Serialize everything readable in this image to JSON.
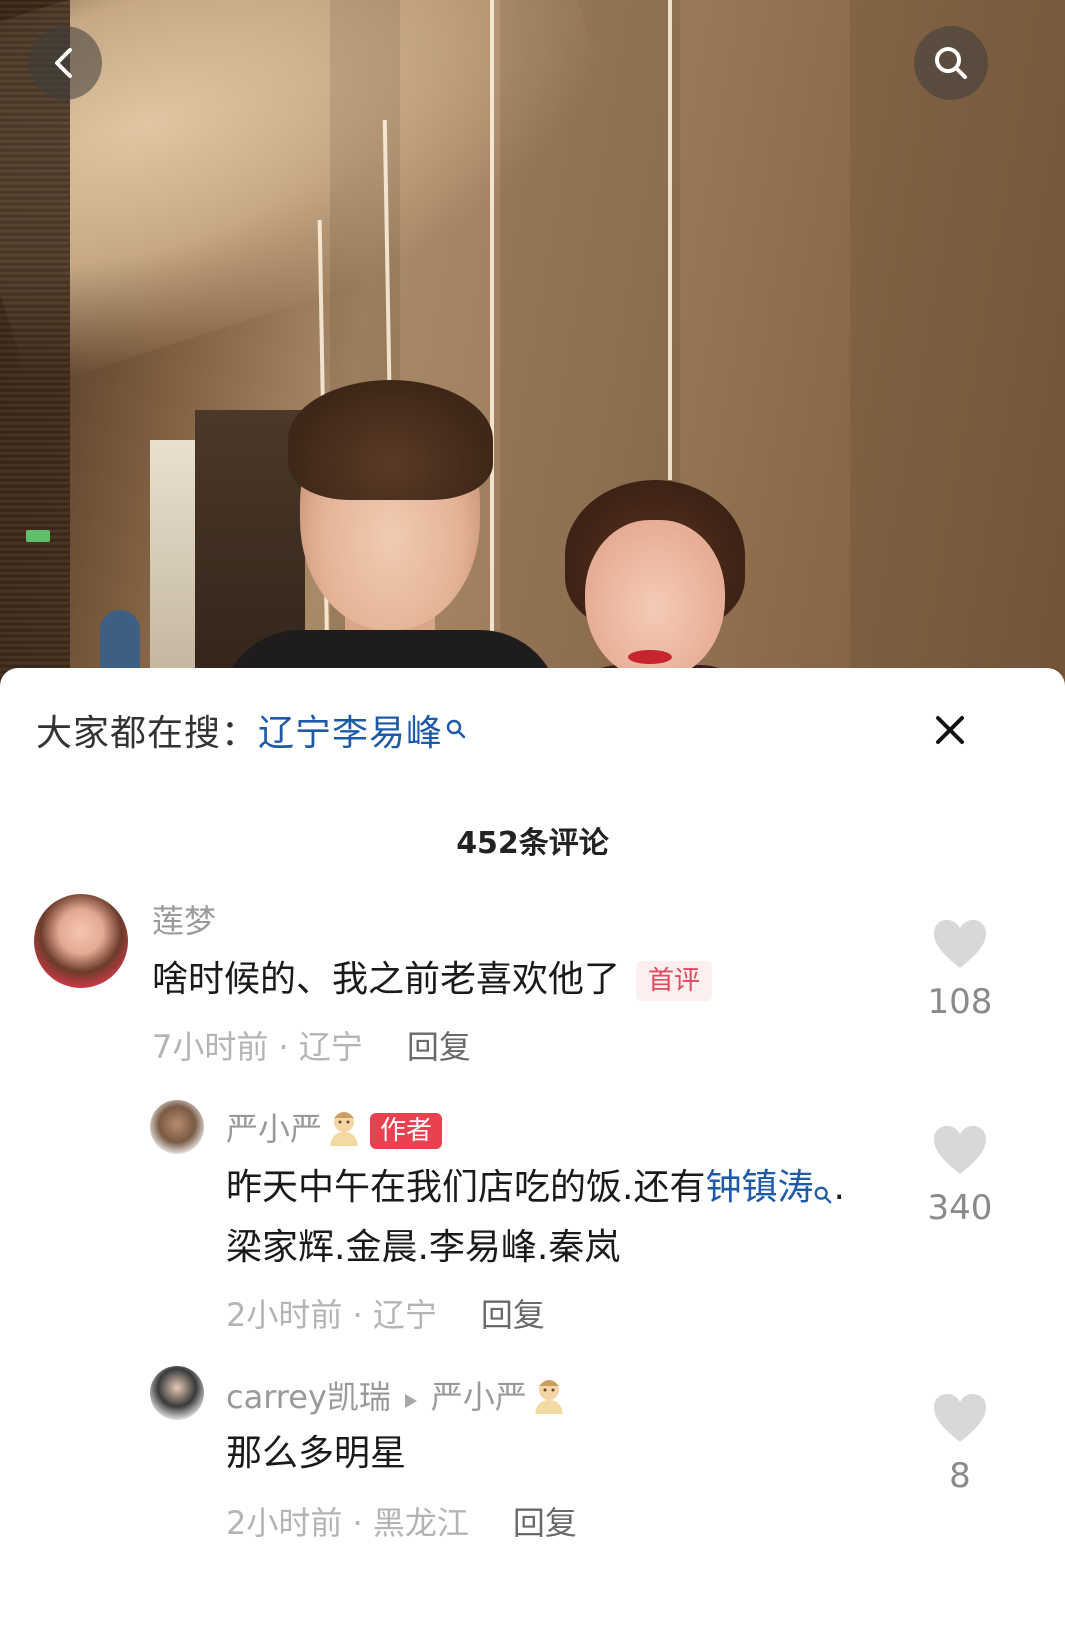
{
  "hot_search": {
    "prefix": "大家都在搜：",
    "keyword": "辽宁李易峰"
  },
  "comments_count": "452条评论",
  "comments": [
    {
      "username": "莲梦",
      "text": "啥时候的、我之前老喜欢他了",
      "badge": "首评",
      "time": "7小时前",
      "location": "辽宁",
      "reply_label": "回复",
      "likes": "108"
    },
    {
      "username": "严小严",
      "badge": "作者",
      "text_part1": "昨天中午在我们店吃的饭.还有",
      "text_link": "钟镇涛",
      "text_part2": ".",
      "text_line2": "梁家辉.金晨.李易峰.秦岚",
      "time": "2小时前",
      "location": "辽宁",
      "reply_label": "回复",
      "likes": "340"
    },
    {
      "username": "carrey凯瑞",
      "reply_to": "严小严",
      "text": "那么多明星",
      "time": "2小时前",
      "location": "黑龙江",
      "reply_label": "回复",
      "likes": "8"
    }
  ],
  "meta_separator": " · ",
  "icons": {
    "back": "chevron-left-icon",
    "search": "search-icon",
    "close": "close-icon",
    "like": "heart-icon"
  },
  "colors": {
    "link": "#1f5aa8",
    "author_badge": "#e8414f",
    "first_badge": "#e04a5c"
  }
}
